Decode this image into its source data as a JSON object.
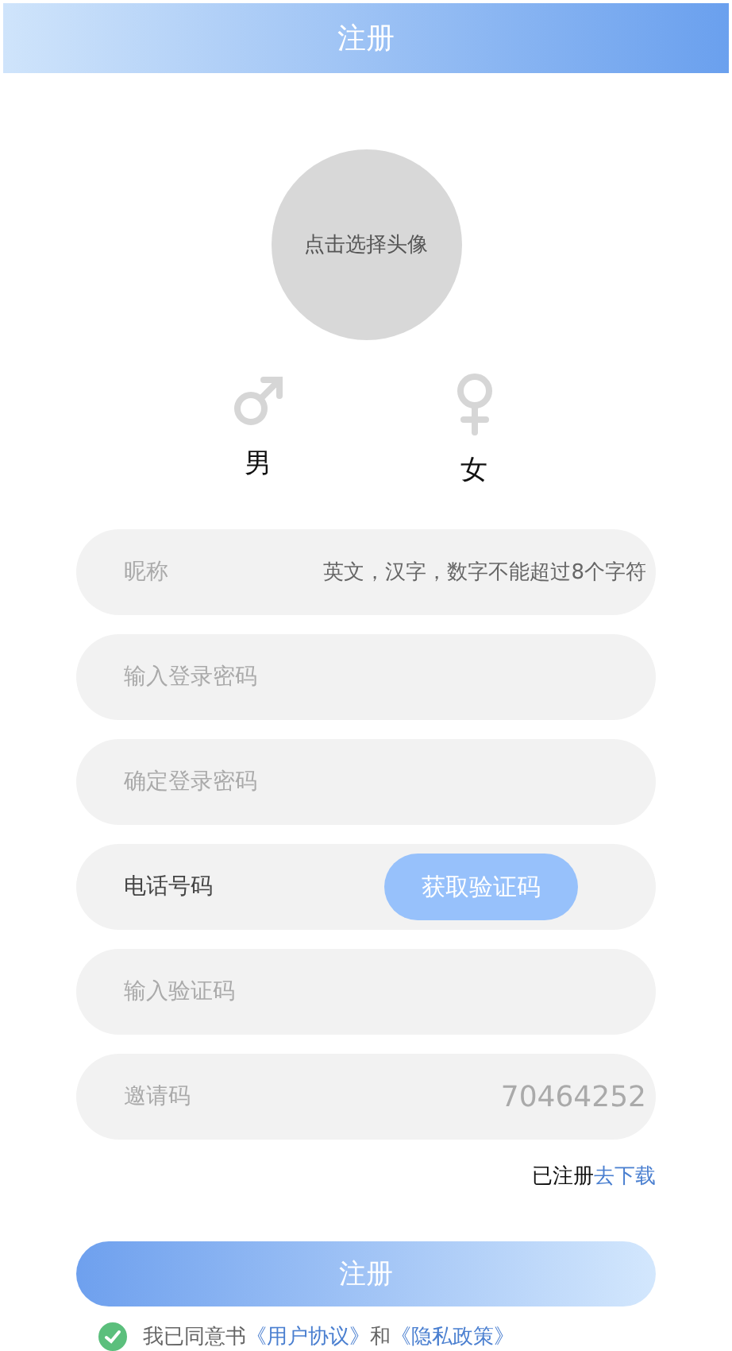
{
  "header": {
    "title": "注册"
  },
  "avatar": {
    "label": "点击选择头像"
  },
  "genders": [
    {
      "kind": "male",
      "label": "男",
      "selected": false
    },
    {
      "kind": "female",
      "label": "女",
      "selected": false
    }
  ],
  "fields": [
    {
      "kind": "labeled",
      "label": "昵称",
      "placeholder": "英文，汉字，数字不能超过8个字符"
    },
    {
      "kind": "plain",
      "placeholder": "输入登录密码"
    },
    {
      "kind": "plain",
      "placeholder": "确定登录密码"
    },
    {
      "kind": "phone",
      "placeholder": "电话号码",
      "button": "获取验证码"
    },
    {
      "kind": "plain",
      "placeholder": "输入验证码"
    },
    {
      "kind": "labeled",
      "label": "邀请码",
      "value": "70464252"
    }
  ],
  "login_hint": {
    "text": "已注册",
    "link": "去下载"
  },
  "submit": "注册",
  "agreement": {
    "checked": true,
    "text": "我已同意书",
    "link1": "《用户协议》",
    "middle": "和",
    "link2": "《隐私政策》"
  }
}
